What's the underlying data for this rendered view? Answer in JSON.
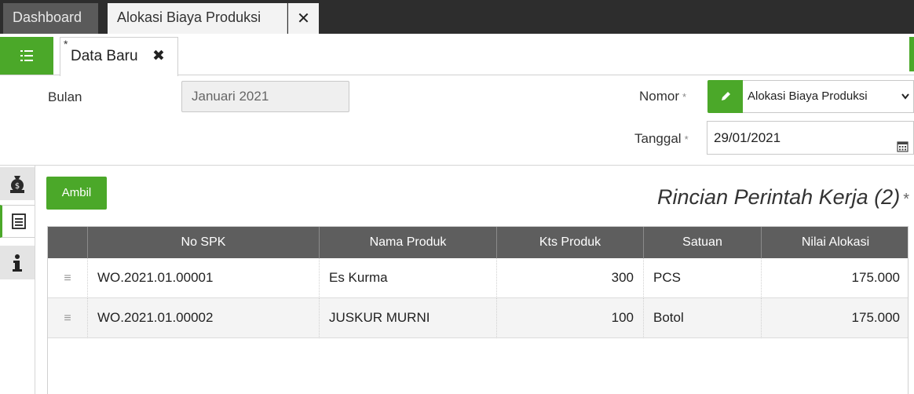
{
  "tabs": {
    "dashboard": "Dashboard",
    "active": "Alokasi Biaya Produksi",
    "close": "✕"
  },
  "doc_tab": {
    "star": "*",
    "label": "Data Baru",
    "close": "✖"
  },
  "form": {
    "bulan_label": "Bulan",
    "bulan_value": "Januari 2021",
    "nomor_label": "Nomor",
    "nomor_value": "Alokasi Biaya Produksi",
    "tanggal_label": "Tanggal",
    "tanggal_value": "29/01/2021",
    "required_mark": "*"
  },
  "detail": {
    "ambil_label": "Ambil",
    "title": "Rincian Perintah Kerja (2)",
    "required_mark": "*"
  },
  "table": {
    "headers": [
      "No SPK",
      "Nama Produk",
      "Kts Produk",
      "Satuan",
      "Nilai Alokasi"
    ],
    "rows": [
      {
        "handle": "≡",
        "no_spk": "WO.2021.01.00001",
        "nama_produk": "Es Kurma",
        "kts_produk": "300",
        "satuan": "PCS",
        "nilai_alokasi": "175.000"
      },
      {
        "handle": "≡",
        "no_spk": "WO.2021.01.00002",
        "nama_produk": "JUSKUR MURNI",
        "kts_produk": "100",
        "satuan": "Botol",
        "nilai_alokasi": "175.000"
      }
    ]
  },
  "colors": {
    "accent": "#4ba829",
    "topbar": "#2d2d2d",
    "table_header": "#5e5e5e"
  },
  "icons": {
    "menu": "list-menu-icon",
    "edit": "pencil-icon",
    "calendar": "calendar-icon",
    "money": "money-bag-icon",
    "list": "document-list-icon",
    "info": "info-icon",
    "dropdown": "chevron-down-icon"
  }
}
